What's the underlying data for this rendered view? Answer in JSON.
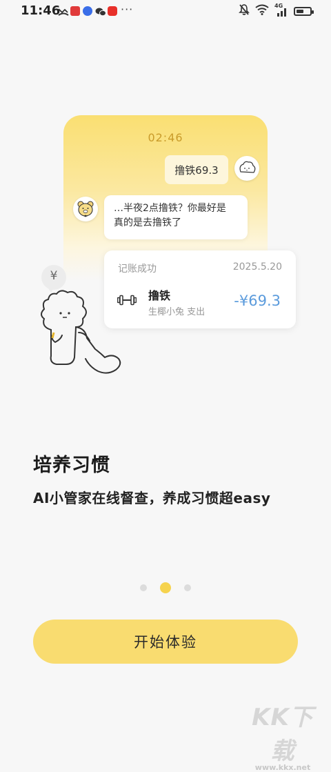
{
  "status_bar": {
    "time": "11:46",
    "signal_label": "4G",
    "more": "···",
    "app_icons": [
      {
        "name": "missed-call-icon",
        "color": "#333333"
      },
      {
        "name": "huawei-app-icon",
        "color": "#e03a3a"
      },
      {
        "name": "music-app-icon",
        "color": "#3a6ee8"
      },
      {
        "name": "wechat-icon",
        "color": "#333333"
      },
      {
        "name": "red-app-icon",
        "color": "#e8302a"
      }
    ]
  },
  "illustration": {
    "time": "02:46",
    "user_message": "撸铁69.3",
    "ai_reply_line1": "…半夜2点撸铁？你最好是",
    "ai_reply_line2": "真的是去撸铁了",
    "record": {
      "status": "记账成功",
      "date": "2025.5.20",
      "item_name": "撸铁",
      "item_meta": "生椰小兔 支出",
      "amount": "-¥69.3",
      "amount_color": "#5b9bdc"
    },
    "mascot_symbol": "¥"
  },
  "onboarding": {
    "title": "培养习惯",
    "subtitle": "AI小管家在线督查，养成习惯超easy",
    "page_index": 2,
    "page_count": 3,
    "cta_label": "开始体验",
    "accent_color": "#f9dc70"
  },
  "watermark": {
    "logo": "KK下载",
    "url": "www.kkx.net"
  }
}
